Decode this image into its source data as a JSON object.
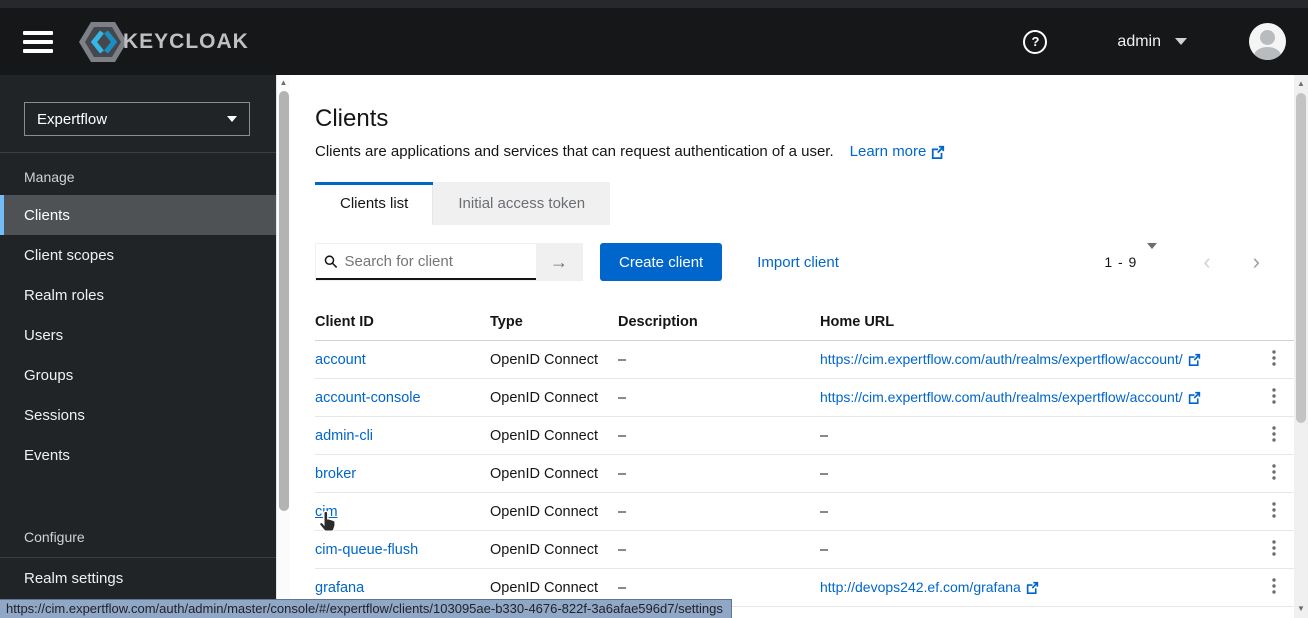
{
  "masthead": {
    "brand": "KEYCLOAK",
    "help": "?",
    "user": "admin"
  },
  "sidebar": {
    "realm": "Expertflow",
    "manage_label": "Manage",
    "manage_items": [
      "Clients",
      "Client scopes",
      "Realm roles",
      "Users",
      "Groups",
      "Sessions",
      "Events"
    ],
    "active_item": "Clients",
    "configure_label": "Configure",
    "configure_items": [
      "Realm settings"
    ]
  },
  "page": {
    "title": "Clients",
    "subtitle": "Clients are applications and services that can request authentication of a user.",
    "learn_more": "Learn more"
  },
  "tabs": [
    {
      "label": "Clients list",
      "active": true
    },
    {
      "label": "Initial access token",
      "active": false
    }
  ],
  "toolbar": {
    "search_placeholder": "Search for client",
    "search_go": "→",
    "create_button": "Create client",
    "import_link": "Import client",
    "pagination_range": "1 - 9"
  },
  "table": {
    "columns": [
      "Client ID",
      "Type",
      "Description",
      "Home URL"
    ],
    "rows": [
      {
        "client_id": "account",
        "type": "OpenID Connect",
        "description": "–",
        "home_url": "https://cim.expertflow.com/auth/realms/expertflow/account/"
      },
      {
        "client_id": "account-console",
        "type": "OpenID Connect",
        "description": "–",
        "home_url": "https://cim.expertflow.com/auth/realms/expertflow/account/"
      },
      {
        "client_id": "admin-cli",
        "type": "OpenID Connect",
        "description": "–",
        "home_url": "–"
      },
      {
        "client_id": "broker",
        "type": "OpenID Connect",
        "description": "–",
        "home_url": "–"
      },
      {
        "client_id": "cim",
        "type": "OpenID Connect",
        "description": "–",
        "home_url": "–"
      },
      {
        "client_id": "cim-queue-flush",
        "type": "OpenID Connect",
        "description": "–",
        "home_url": "–"
      },
      {
        "client_id": "grafana",
        "type": "OpenID Connect",
        "description": "–",
        "home_url": "http://devops242.ef.com/grafana"
      }
    ]
  },
  "statusbar": {
    "url": "https://cim.expertflow.com/auth/admin/master/console/#/expertflow/clients/103095ae-b330-4676-822f-3a6afae596d7/settings"
  },
  "colors": {
    "accent": "#0066cc",
    "active_nav_bar": "#73bcf7",
    "masthead_bg": "#161719",
    "sidebar_bg": "#212427"
  }
}
